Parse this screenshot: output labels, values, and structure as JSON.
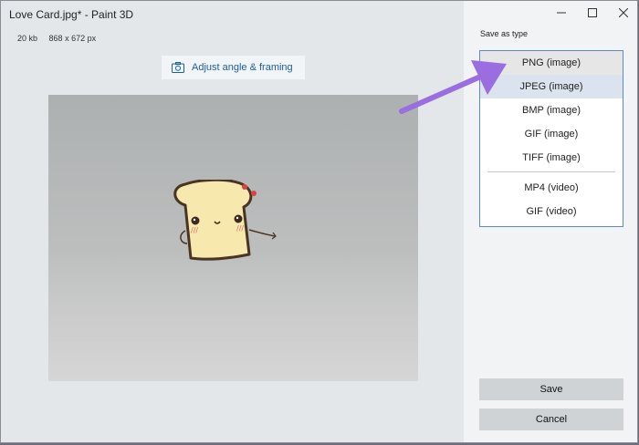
{
  "window": {
    "title": "Love Card.jpg* - Paint 3D"
  },
  "info": {
    "file_size": "20 kb",
    "dimensions": "868 x 672 px"
  },
  "adjust": {
    "label": "Adjust angle & framing",
    "icon": "camera-icon"
  },
  "save_panel": {
    "label": "Save as type",
    "image_types": [
      "PNG (image)",
      "JPEG (image)",
      "BMP (image)",
      "GIF (image)",
      "TIFF (image)"
    ],
    "video_types": [
      "MP4 (video)",
      "GIF (video)"
    ],
    "hovered": "PNG (image)",
    "selected": "JPEG (image)"
  },
  "buttons": {
    "save": "Save",
    "cancel": "Cancel"
  },
  "colors": {
    "accent": "#1a5f9e",
    "arrow": "#9a6ee0",
    "list_border": "#5b8ac7"
  }
}
